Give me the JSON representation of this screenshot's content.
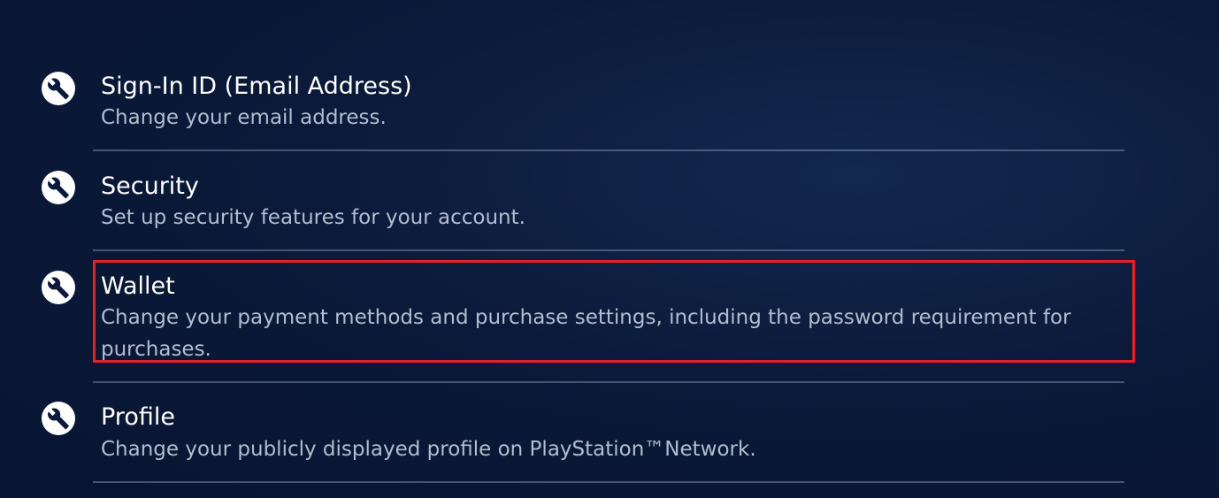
{
  "menu": {
    "items": [
      {
        "icon": "wrench-icon",
        "title": "Sign-In ID (Email Address)",
        "description": "Change your email address."
      },
      {
        "icon": "wrench-icon",
        "title": "Security",
        "description": "Set up security features for your account."
      },
      {
        "icon": "wrench-icon",
        "title": "Wallet",
        "description": "Change your payment methods and purchase settings, including the password requirement for purchases."
      },
      {
        "icon": "wrench-icon",
        "title": "Profile",
        "description": "Change your publicly displayed profile on PlayStation™Network."
      }
    ],
    "highlighted_item": "Wallet"
  },
  "colors": {
    "background": "#0b1a3a",
    "highlight_border": "#e5202a",
    "title_text": "#ffffff",
    "description_text": "#b3bdcf"
  }
}
